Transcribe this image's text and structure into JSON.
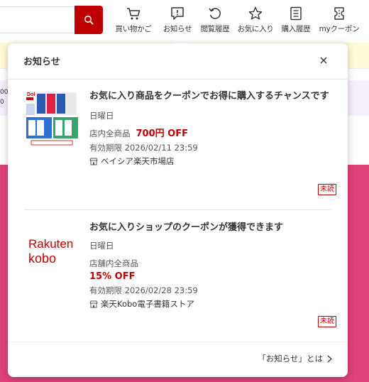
{
  "header": {
    "nav": [
      {
        "label": "買い物かご",
        "icon": "cart-icon"
      },
      {
        "label": "お知らせ",
        "icon": "notice-icon"
      },
      {
        "label": "閲覧履歴",
        "icon": "history-icon"
      },
      {
        "label": "お気に入り",
        "icon": "star-icon"
      },
      {
        "label": "購入履歴",
        "icon": "receipt-icon"
      },
      {
        "label": "myクーポン",
        "icon": "coupon-icon"
      }
    ]
  },
  "background": {
    "cut_text": "00\n0"
  },
  "panel": {
    "title": "お知らせ",
    "notifications": [
      {
        "thumb_brand": "Dolce",
        "title": "お気に入り商品をクーポンでお得に購入するチャンスです",
        "day": "日曜日",
        "scope": "店内全商品",
        "discount": "700円 OFF",
        "expiry": "有効期限 2026/02/11 23:59",
        "shop": "ベイシア楽天市場店",
        "badge": "未読"
      },
      {
        "thumb_brand_line1": "Rakuten",
        "thumb_brand_line2": "kobo",
        "title": "お気に入りショップのクーポンが獲得できます",
        "day": "日曜日",
        "scope": "店舗内全商品",
        "discount": "15% OFF",
        "expiry": "有効期限 2026/02/28 23:59",
        "shop": "楽天Kobo電子書籍ストア",
        "badge": "未読"
      }
    ],
    "footer_link": "「お知らせ」とは"
  },
  "colors": {
    "brand_red": "#bf0000",
    "magenta": "#e0427b",
    "yellow_strip": "#fffad9",
    "pink_strip": "#f7eefb"
  }
}
